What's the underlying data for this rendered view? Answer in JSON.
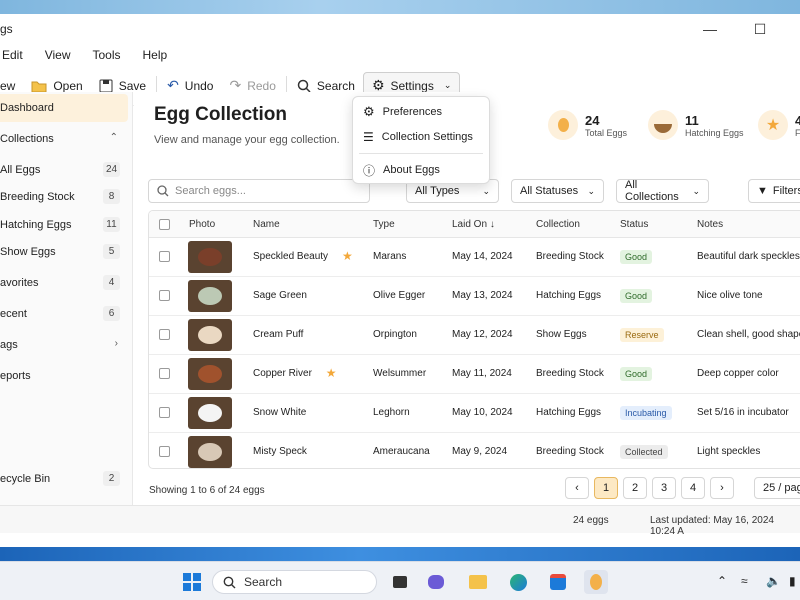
{
  "window": {
    "title": "gs"
  },
  "menubar": [
    "Edit",
    "View",
    "Tools",
    "Help"
  ],
  "toolbar": {
    "new": "ew",
    "open": "Open",
    "save": "Save",
    "undo": "Undo",
    "redo": "Redo",
    "search": "Search",
    "settings": "Settings"
  },
  "settings_menu": {
    "preferences": "Preferences",
    "collection_settings": "Collection Settings",
    "about": "About Eggs"
  },
  "sidebar": {
    "dashboard": "Dashboard",
    "collections": "Collections",
    "items": [
      {
        "label": "All Eggs",
        "count": "24"
      },
      {
        "label": "Breeding Stock",
        "count": "8"
      },
      {
        "label": "Hatching Eggs",
        "count": "11"
      },
      {
        "label": "Show Eggs",
        "count": "5"
      }
    ],
    "favorites": {
      "label": "avorites",
      "count": "4"
    },
    "recent": {
      "label": "ecent",
      "count": "6"
    },
    "tags": "ags",
    "reports": "eports",
    "recycle": {
      "label": "ecycle Bin",
      "count": "2"
    }
  },
  "main": {
    "title": "Egg Collection",
    "subtitle": "View and manage your egg collection.",
    "stats": [
      {
        "num": "24",
        "label": "Total Eggs"
      },
      {
        "num": "11",
        "label": "Hatching Eggs"
      },
      {
        "num": "4",
        "label": "Fa"
      }
    ],
    "search_placeholder": "Search eggs...",
    "filters": {
      "types": "All Types",
      "statuses": "All Statuses",
      "collections": "All Collections",
      "filters": "Filters"
    },
    "columns": [
      "Photo",
      "Name",
      "Type",
      "Laid On",
      "Collection",
      "Status",
      "Notes"
    ],
    "rows": [
      {
        "name": "Speckled Beauty",
        "star": true,
        "type": "Marans",
        "laid": "May 14, 2024",
        "collection": "Breeding Stock",
        "status": "Good",
        "notes": "Beautiful dark speckles",
        "egg": "#7a3f2a"
      },
      {
        "name": "Sage Green",
        "star": false,
        "type": "Olive Egger",
        "laid": "May 13, 2024",
        "collection": "Hatching Eggs",
        "status": "Good",
        "notes": "Nice olive tone",
        "egg": "#bcc9b4"
      },
      {
        "name": "Cream Puff",
        "star": false,
        "type": "Orpington",
        "laid": "May 12, 2024",
        "collection": "Show Eggs",
        "status": "Reserve",
        "notes": "Clean shell, good shape",
        "egg": "#ead8c2"
      },
      {
        "name": "Copper River",
        "star": true,
        "type": "Welsummer",
        "laid": "May 11, 2024",
        "collection": "Breeding Stock",
        "status": "Good",
        "notes": "Deep copper color",
        "egg": "#a0522d"
      },
      {
        "name": "Snow White",
        "star": false,
        "type": "Leghorn",
        "laid": "May 10, 2024",
        "collection": "Hatching Eggs",
        "status": "Incubating",
        "notes": "Set 5/16 in incubator",
        "egg": "#f4f4f4"
      },
      {
        "name": "Misty Speck",
        "star": false,
        "type": "Ameraucana",
        "laid": "May 9, 2024",
        "collection": "Breeding Stock",
        "status": "Collected",
        "notes": "Light speckles",
        "egg": "#d8c8b6"
      }
    ],
    "showing": "Showing 1 to 6 of 24 eggs",
    "pages": [
      "1",
      "2",
      "3",
      "4"
    ],
    "per_page": "25 / pag"
  },
  "statusbar": {
    "count": "24 eggs",
    "updated": "Last updated: May 16, 2024 10:24 A"
  },
  "taskbar": {
    "search": "Search"
  },
  "colors": {
    "accent": "#f3a83a",
    "good_bg": "#e3f3e0",
    "good_fg": "#2f6b2a",
    "reserve_bg": "#fdf1d8",
    "reserve_fg": "#9a6a10",
    "incubating_bg": "#e4eefc",
    "incubating_fg": "#2a5aa8",
    "collected_bg": "#ececec",
    "collected_fg": "#444"
  }
}
